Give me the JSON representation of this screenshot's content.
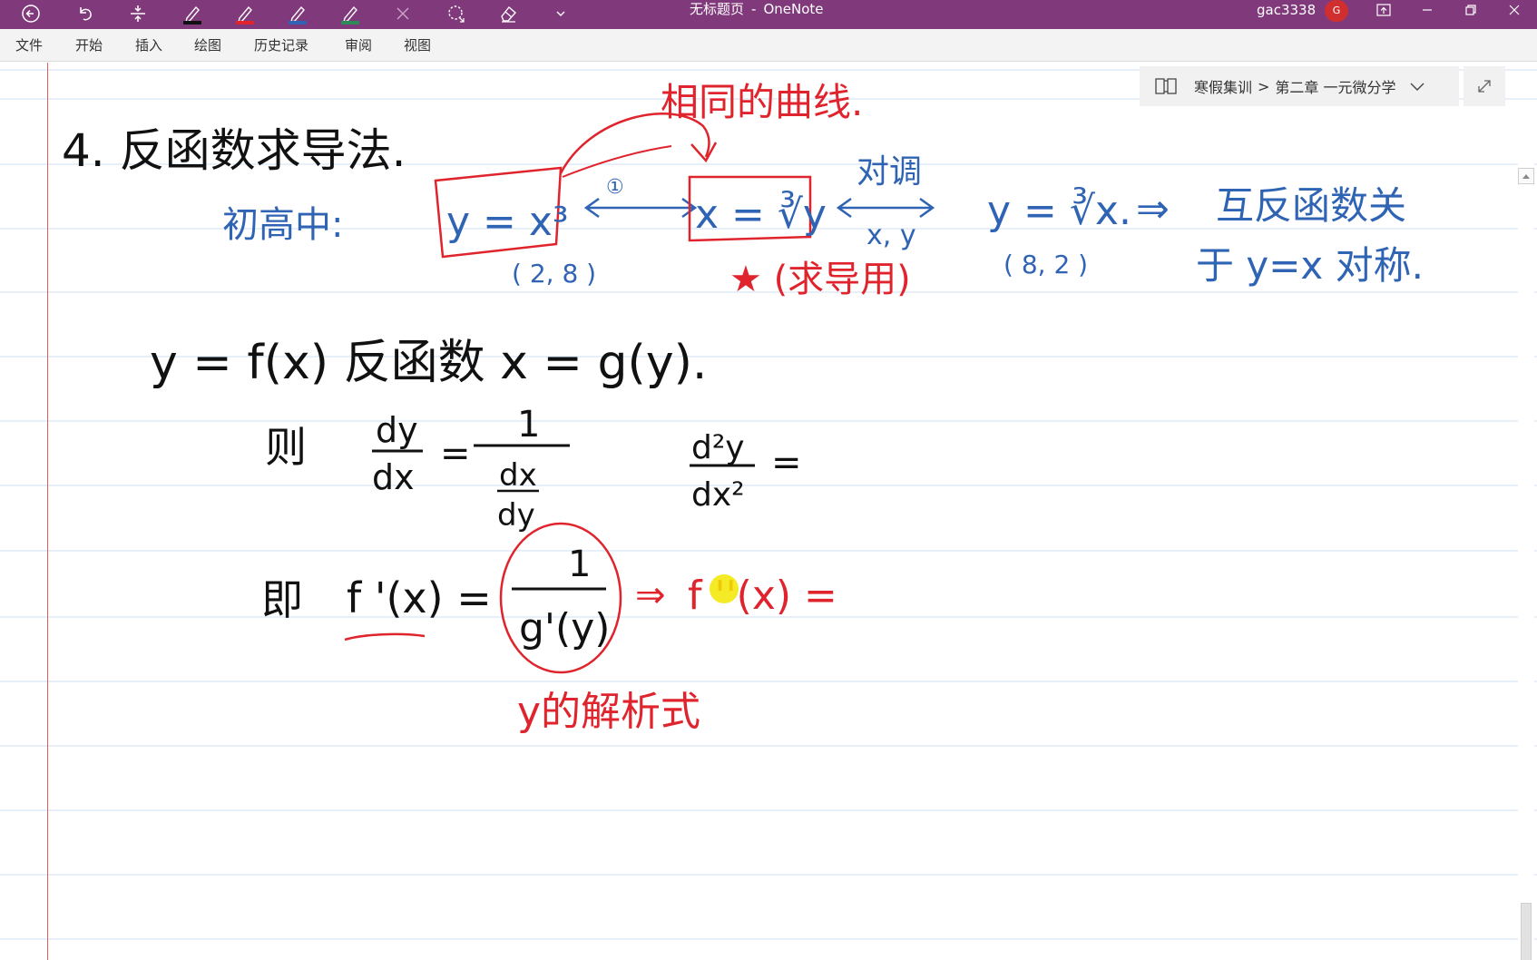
{
  "window": {
    "title": "无标题页",
    "app_name": "OneNote",
    "title_separator": "-",
    "user": "gac3338",
    "avatar_letter": "G"
  },
  "colors": {
    "titlebar": "#80397b",
    "pen_black": "#111111",
    "pen_red": "#e0242d",
    "pen_blue": "#2f63b4",
    "pen_green": "#2e8b57",
    "margin": "#e25a5a",
    "ruling": "#cfe2f3"
  },
  "quick_access": [
    {
      "icon": "back-arrow-icon"
    },
    {
      "icon": "undo-icon"
    },
    {
      "icon": "insert-space-icon"
    },
    {
      "icon": "pen-black-icon"
    },
    {
      "icon": "pen-red-icon"
    },
    {
      "icon": "pen-blue-icon"
    },
    {
      "icon": "pen-green-icon"
    },
    {
      "icon": "close-icon"
    },
    {
      "icon": "lasso-select-icon"
    },
    {
      "icon": "eraser-icon"
    },
    {
      "icon": "dropdown-chevron-icon"
    }
  ],
  "menu": {
    "items": [
      "文件",
      "开始",
      "插入",
      "绘图",
      "历史记录",
      "审阅",
      "视图"
    ]
  },
  "breadcrumb": {
    "notebook": "寒假集训",
    "separator": ">",
    "section": "第二章 一元微分学"
  },
  "notes": {
    "heading": "4. 反函数求导法.",
    "red_top": "相同的曲线.",
    "blue_label": "初高中:",
    "box1": "y = x³",
    "circled_one": "①",
    "box2": "x = ∛y",
    "swap_label": "对调",
    "swap_vars": "x, y",
    "y_cbrt": "y = ∛x.",
    "implies_1": "⇒",
    "inverse_relation_1": "互反函数关",
    "inverse_relation_2": "于 y=x 对称.",
    "pt_28": "( 2, 8 )",
    "pt_82": "( 8, 2 )",
    "star_note": "★ (求导用)",
    "def_line": "y = f(x) 反函数 x = g(y).",
    "ze": "则",
    "dy": "dy",
    "dx": "dx",
    "eq": "=",
    "one": "1",
    "dx_over": "dx",
    "dy_under": "dy",
    "d2y": "d²y",
    "dx2": "dx²",
    "ji": "即",
    "fprime": "f '(x) =",
    "gprime": "g'(y)",
    "implies_2": "⇒",
    "f_double_prime": "f ''(x) =",
    "jiexi": "y的解析式"
  }
}
